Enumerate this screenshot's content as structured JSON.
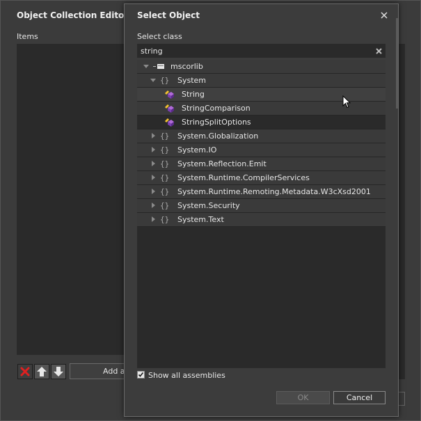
{
  "background_window": {
    "title": "Object Collection Editor: Ite",
    "items_label": "Items",
    "add_button_label": "Add a"
  },
  "dialog": {
    "title": "Select Object",
    "select_class_label": "Select class",
    "search_value": "string",
    "tree": [
      {
        "label": "mscorlib",
        "kind": "assembly",
        "expanded": true
      },
      {
        "label": "System",
        "kind": "namespace",
        "expanded": true
      },
      {
        "label": "String",
        "kind": "class",
        "selected": true
      },
      {
        "label": "StringComparison",
        "kind": "class"
      },
      {
        "label": "StringSplitOptions",
        "kind": "class"
      },
      {
        "label": "System.Globalization",
        "kind": "namespace",
        "expanded": false
      },
      {
        "label": "System.IO",
        "kind": "namespace",
        "expanded": false
      },
      {
        "label": "System.Reflection.Emit",
        "kind": "namespace",
        "expanded": false
      },
      {
        "label": "System.Runtime.CompilerServices",
        "kind": "namespace",
        "expanded": false
      },
      {
        "label": "System.Runtime.Remoting.Metadata.W3cXsd2001",
        "kind": "namespace",
        "expanded": false
      },
      {
        "label": "System.Security",
        "kind": "namespace",
        "expanded": false
      },
      {
        "label": "System.Text",
        "kind": "namespace",
        "expanded": false
      }
    ],
    "namespace_glyph": "{}",
    "show_all_assemblies_label": "Show all assemblies",
    "show_all_assemblies_checked": true,
    "ok_label": "OK",
    "cancel_label": "Cancel"
  },
  "colors": {
    "accent_remove": "#e02020",
    "dialog_bg": "#3c3c3c",
    "list_bg": "#2a2a2a"
  }
}
